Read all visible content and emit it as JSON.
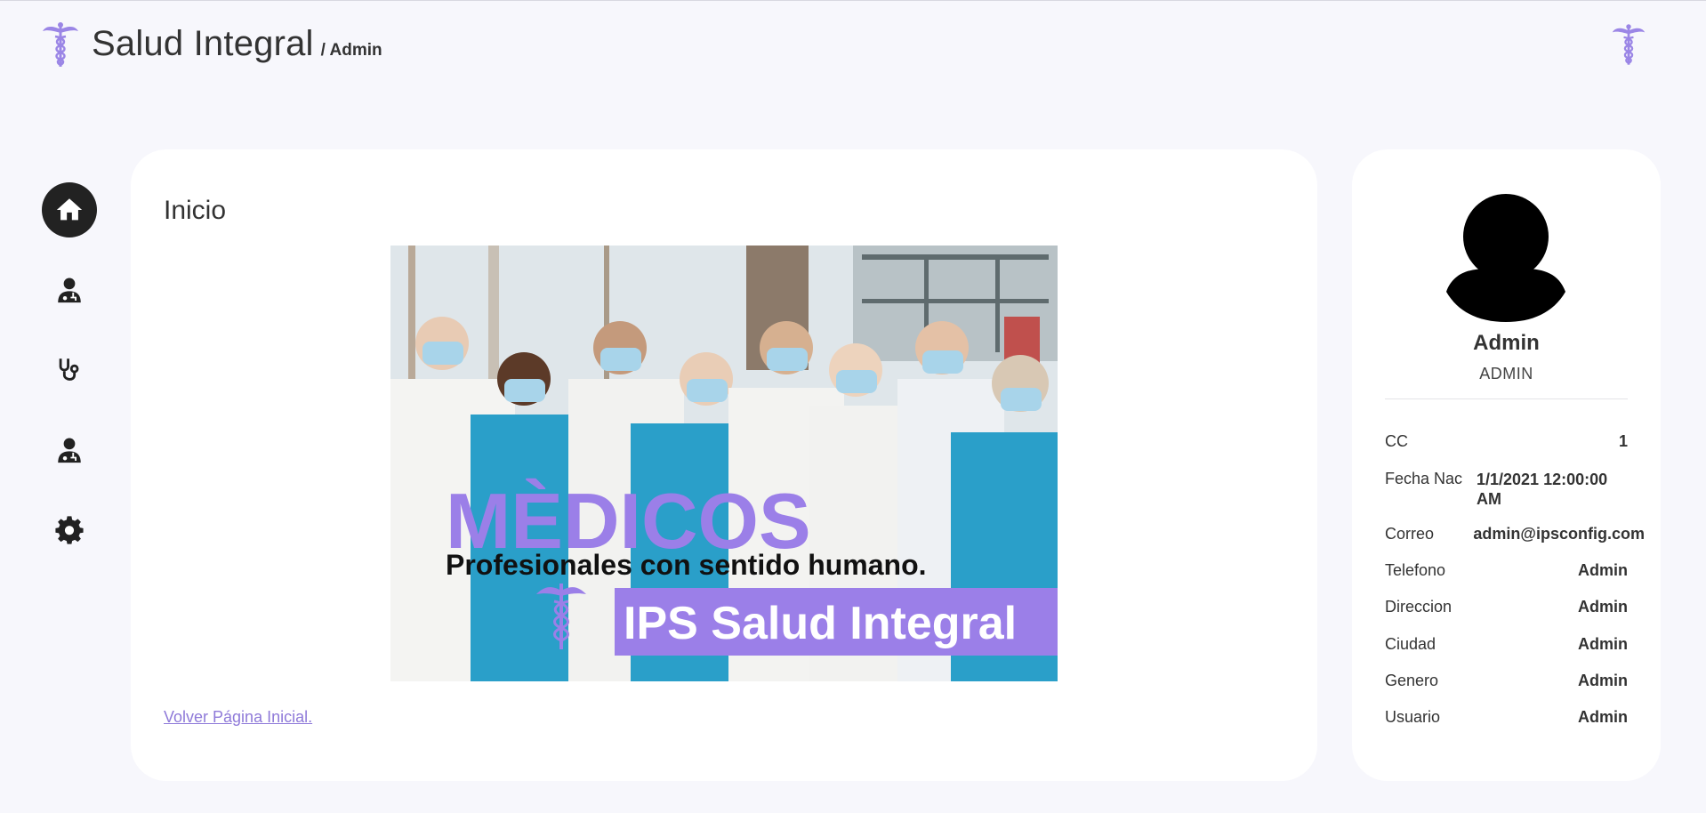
{
  "header": {
    "title": "Salud Integral",
    "subtitle": "/ Admin",
    "logo_icon": "caduceus-icon",
    "accent_color": "#9b86e6"
  },
  "sidebar": {
    "items": [
      {
        "icon": "home-icon",
        "active": true
      },
      {
        "icon": "doctor-icon",
        "active": false
      },
      {
        "icon": "stethoscope-icon",
        "active": false
      },
      {
        "icon": "doctor-icon",
        "active": false
      },
      {
        "icon": "gear-icon",
        "active": false
      }
    ]
  },
  "main": {
    "title": "Inicio",
    "banner": {
      "headline": "MÈDICOS",
      "tagline": "Profesionales con sentido humano.",
      "brand": "IPS Salud Integral",
      "brand_color": "#9b7fe8"
    },
    "back_link": "Volver Página Inicial."
  },
  "profile": {
    "name": "Admin",
    "role": "ADMIN",
    "fields": {
      "cc_label": "CC",
      "cc_value": "1",
      "fecha_label": "Fecha Nac",
      "fecha_value": "1/1/2021 12:00:00 AM",
      "correo_label": "Correo",
      "correo_value": "admin@ipsconfig.com",
      "telefono_label": "Telefono",
      "telefono_value": "Admin",
      "direccion_label": "Direccion",
      "direccion_value": "Admin",
      "ciudad_label": "Ciudad",
      "ciudad_value": "Admin",
      "genero_label": "Genero",
      "genero_value": "Admin",
      "usuario_label": "Usuario",
      "usuario_value": "Admin"
    }
  }
}
